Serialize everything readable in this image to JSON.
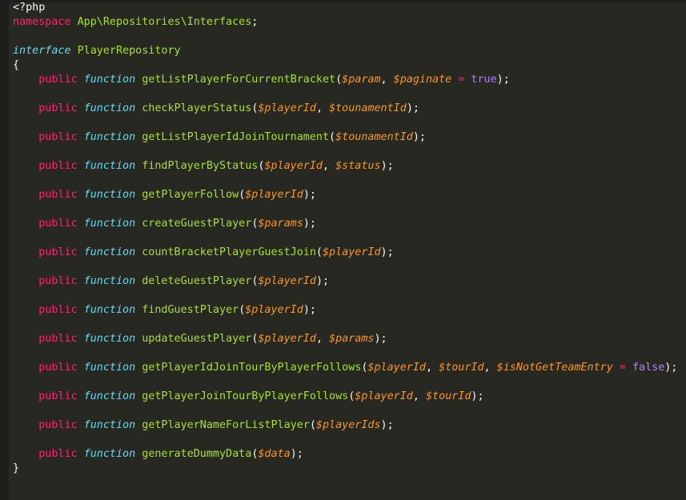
{
  "colors": {
    "background": "#272822",
    "gutter": "#1e1f1b",
    "text": "#f8f8f2",
    "keyword": "#f92672",
    "storage_type": "#66d9ef",
    "entity_name": "#a6e22e",
    "variable": "#fd971f",
    "constant": "#ae81ff"
  },
  "lines": [
    [
      {
        "t": "<?php",
        "c": "plain"
      }
    ],
    [
      {
        "t": "namespace",
        "c": "keyword"
      },
      {
        "t": " ",
        "c": "plain"
      },
      {
        "t": "App\\Repositories\\Interfaces",
        "c": "name"
      },
      {
        "t": ";",
        "c": "plain"
      }
    ],
    [],
    [
      {
        "t": "interface",
        "c": "type"
      },
      {
        "t": " ",
        "c": "plain"
      },
      {
        "t": "PlayerRepository",
        "c": "name"
      }
    ],
    [
      {
        "t": "{",
        "c": "plain"
      }
    ],
    [
      {
        "t": "    ",
        "c": "plain"
      },
      {
        "t": "public",
        "c": "keyword"
      },
      {
        "t": " ",
        "c": "plain"
      },
      {
        "t": "function",
        "c": "type"
      },
      {
        "t": " ",
        "c": "plain"
      },
      {
        "t": "getListPlayerForCurrentBracket",
        "c": "name"
      },
      {
        "t": "(",
        "c": "plain"
      },
      {
        "t": "$param",
        "c": "var"
      },
      {
        "t": ", ",
        "c": "plain"
      },
      {
        "t": "$paginate",
        "c": "var"
      },
      {
        "t": " ",
        "c": "plain"
      },
      {
        "t": "=",
        "c": "keyword"
      },
      {
        "t": " ",
        "c": "plain"
      },
      {
        "t": "true",
        "c": "const"
      },
      {
        "t": ");",
        "c": "plain"
      }
    ],
    [],
    [
      {
        "t": "    ",
        "c": "plain"
      },
      {
        "t": "public",
        "c": "keyword"
      },
      {
        "t": " ",
        "c": "plain"
      },
      {
        "t": "function",
        "c": "type"
      },
      {
        "t": " ",
        "c": "plain"
      },
      {
        "t": "checkPlayerStatus",
        "c": "name"
      },
      {
        "t": "(",
        "c": "plain"
      },
      {
        "t": "$playerId",
        "c": "var"
      },
      {
        "t": ", ",
        "c": "plain"
      },
      {
        "t": "$tounamentId",
        "c": "var"
      },
      {
        "t": ");",
        "c": "plain"
      }
    ],
    [],
    [
      {
        "t": "    ",
        "c": "plain"
      },
      {
        "t": "public",
        "c": "keyword"
      },
      {
        "t": " ",
        "c": "plain"
      },
      {
        "t": "function",
        "c": "type"
      },
      {
        "t": " ",
        "c": "plain"
      },
      {
        "t": "getListPlayerIdJoinTournament",
        "c": "name"
      },
      {
        "t": "(",
        "c": "plain"
      },
      {
        "t": "$tounamentId",
        "c": "var"
      },
      {
        "t": ");",
        "c": "plain"
      }
    ],
    [],
    [
      {
        "t": "    ",
        "c": "plain"
      },
      {
        "t": "public",
        "c": "keyword"
      },
      {
        "t": " ",
        "c": "plain"
      },
      {
        "t": "function",
        "c": "type"
      },
      {
        "t": " ",
        "c": "plain"
      },
      {
        "t": "findPlayerByStatus",
        "c": "name"
      },
      {
        "t": "(",
        "c": "plain"
      },
      {
        "t": "$playerId",
        "c": "var"
      },
      {
        "t": ", ",
        "c": "plain"
      },
      {
        "t": "$status",
        "c": "var"
      },
      {
        "t": ");",
        "c": "plain"
      }
    ],
    [],
    [
      {
        "t": "    ",
        "c": "plain"
      },
      {
        "t": "public",
        "c": "keyword"
      },
      {
        "t": " ",
        "c": "plain"
      },
      {
        "t": "function",
        "c": "type"
      },
      {
        "t": " ",
        "c": "plain"
      },
      {
        "t": "getPlayerFollow",
        "c": "name"
      },
      {
        "t": "(",
        "c": "plain"
      },
      {
        "t": "$playerId",
        "c": "var"
      },
      {
        "t": ");",
        "c": "plain"
      }
    ],
    [],
    [
      {
        "t": "    ",
        "c": "plain"
      },
      {
        "t": "public",
        "c": "keyword"
      },
      {
        "t": " ",
        "c": "plain"
      },
      {
        "t": "function",
        "c": "type"
      },
      {
        "t": " ",
        "c": "plain"
      },
      {
        "t": "createGuestPlayer",
        "c": "name"
      },
      {
        "t": "(",
        "c": "plain"
      },
      {
        "t": "$params",
        "c": "var"
      },
      {
        "t": ");",
        "c": "plain"
      }
    ],
    [],
    [
      {
        "t": "    ",
        "c": "plain"
      },
      {
        "t": "public",
        "c": "keyword"
      },
      {
        "t": " ",
        "c": "plain"
      },
      {
        "t": "function",
        "c": "type"
      },
      {
        "t": " ",
        "c": "plain"
      },
      {
        "t": "countBracketPlayerGuestJoin",
        "c": "name"
      },
      {
        "t": "(",
        "c": "plain"
      },
      {
        "t": "$playerId",
        "c": "var"
      },
      {
        "t": ");",
        "c": "plain"
      }
    ],
    [],
    [
      {
        "t": "    ",
        "c": "plain"
      },
      {
        "t": "public",
        "c": "keyword"
      },
      {
        "t": " ",
        "c": "plain"
      },
      {
        "t": "function",
        "c": "type"
      },
      {
        "t": " ",
        "c": "plain"
      },
      {
        "t": "deleteGuestPlayer",
        "c": "name"
      },
      {
        "t": "(",
        "c": "plain"
      },
      {
        "t": "$playerId",
        "c": "var"
      },
      {
        "t": ");",
        "c": "plain"
      }
    ],
    [],
    [
      {
        "t": "    ",
        "c": "plain"
      },
      {
        "t": "public",
        "c": "keyword"
      },
      {
        "t": " ",
        "c": "plain"
      },
      {
        "t": "function",
        "c": "type"
      },
      {
        "t": " ",
        "c": "plain"
      },
      {
        "t": "findGuestPlayer",
        "c": "name"
      },
      {
        "t": "(",
        "c": "plain"
      },
      {
        "t": "$playerId",
        "c": "var"
      },
      {
        "t": ");",
        "c": "plain"
      }
    ],
    [],
    [
      {
        "t": "    ",
        "c": "plain"
      },
      {
        "t": "public",
        "c": "keyword"
      },
      {
        "t": " ",
        "c": "plain"
      },
      {
        "t": "function",
        "c": "type"
      },
      {
        "t": " ",
        "c": "plain"
      },
      {
        "t": "updateGuestPlayer",
        "c": "name"
      },
      {
        "t": "(",
        "c": "plain"
      },
      {
        "t": "$playerId",
        "c": "var"
      },
      {
        "t": ", ",
        "c": "plain"
      },
      {
        "t": "$params",
        "c": "var"
      },
      {
        "t": ");",
        "c": "plain"
      }
    ],
    [],
    [
      {
        "t": "    ",
        "c": "plain"
      },
      {
        "t": "public",
        "c": "keyword"
      },
      {
        "t": " ",
        "c": "plain"
      },
      {
        "t": "function",
        "c": "type"
      },
      {
        "t": " ",
        "c": "plain"
      },
      {
        "t": "getPlayerIdJoinTourByPlayerFollows",
        "c": "name"
      },
      {
        "t": "(",
        "c": "plain"
      },
      {
        "t": "$playerId",
        "c": "var"
      },
      {
        "t": ", ",
        "c": "plain"
      },
      {
        "t": "$tourId",
        "c": "var"
      },
      {
        "t": ", ",
        "c": "plain"
      },
      {
        "t": "$isNotGetTeamEntry",
        "c": "var"
      },
      {
        "t": " ",
        "c": "plain"
      },
      {
        "t": "=",
        "c": "keyword"
      },
      {
        "t": " ",
        "c": "plain"
      },
      {
        "t": "false",
        "c": "const"
      },
      {
        "t": ");",
        "c": "plain"
      }
    ],
    [],
    [
      {
        "t": "    ",
        "c": "plain"
      },
      {
        "t": "public",
        "c": "keyword"
      },
      {
        "t": " ",
        "c": "plain"
      },
      {
        "t": "function",
        "c": "type"
      },
      {
        "t": " ",
        "c": "plain"
      },
      {
        "t": "getPlayerJoinTourByPlayerFollows",
        "c": "name"
      },
      {
        "t": "(",
        "c": "plain"
      },
      {
        "t": "$playerId",
        "c": "var"
      },
      {
        "t": ", ",
        "c": "plain"
      },
      {
        "t": "$tourId",
        "c": "var"
      },
      {
        "t": ");",
        "c": "plain"
      }
    ],
    [],
    [
      {
        "t": "    ",
        "c": "plain"
      },
      {
        "t": "public",
        "c": "keyword"
      },
      {
        "t": " ",
        "c": "plain"
      },
      {
        "t": "function",
        "c": "type"
      },
      {
        "t": " ",
        "c": "plain"
      },
      {
        "t": "getPlayerNameForListPlayer",
        "c": "name"
      },
      {
        "t": "(",
        "c": "plain"
      },
      {
        "t": "$playerIds",
        "c": "var"
      },
      {
        "t": ");",
        "c": "plain"
      }
    ],
    [],
    [
      {
        "t": "    ",
        "c": "plain"
      },
      {
        "t": "public",
        "c": "keyword"
      },
      {
        "t": " ",
        "c": "plain"
      },
      {
        "t": "function",
        "c": "type"
      },
      {
        "t": " ",
        "c": "plain"
      },
      {
        "t": "generateDummyData",
        "c": "name"
      },
      {
        "t": "(",
        "c": "plain"
      },
      {
        "t": "$data",
        "c": "var"
      },
      {
        "t": ");",
        "c": "plain"
      }
    ],
    [
      {
        "t": "}",
        "c": "plain"
      }
    ]
  ]
}
